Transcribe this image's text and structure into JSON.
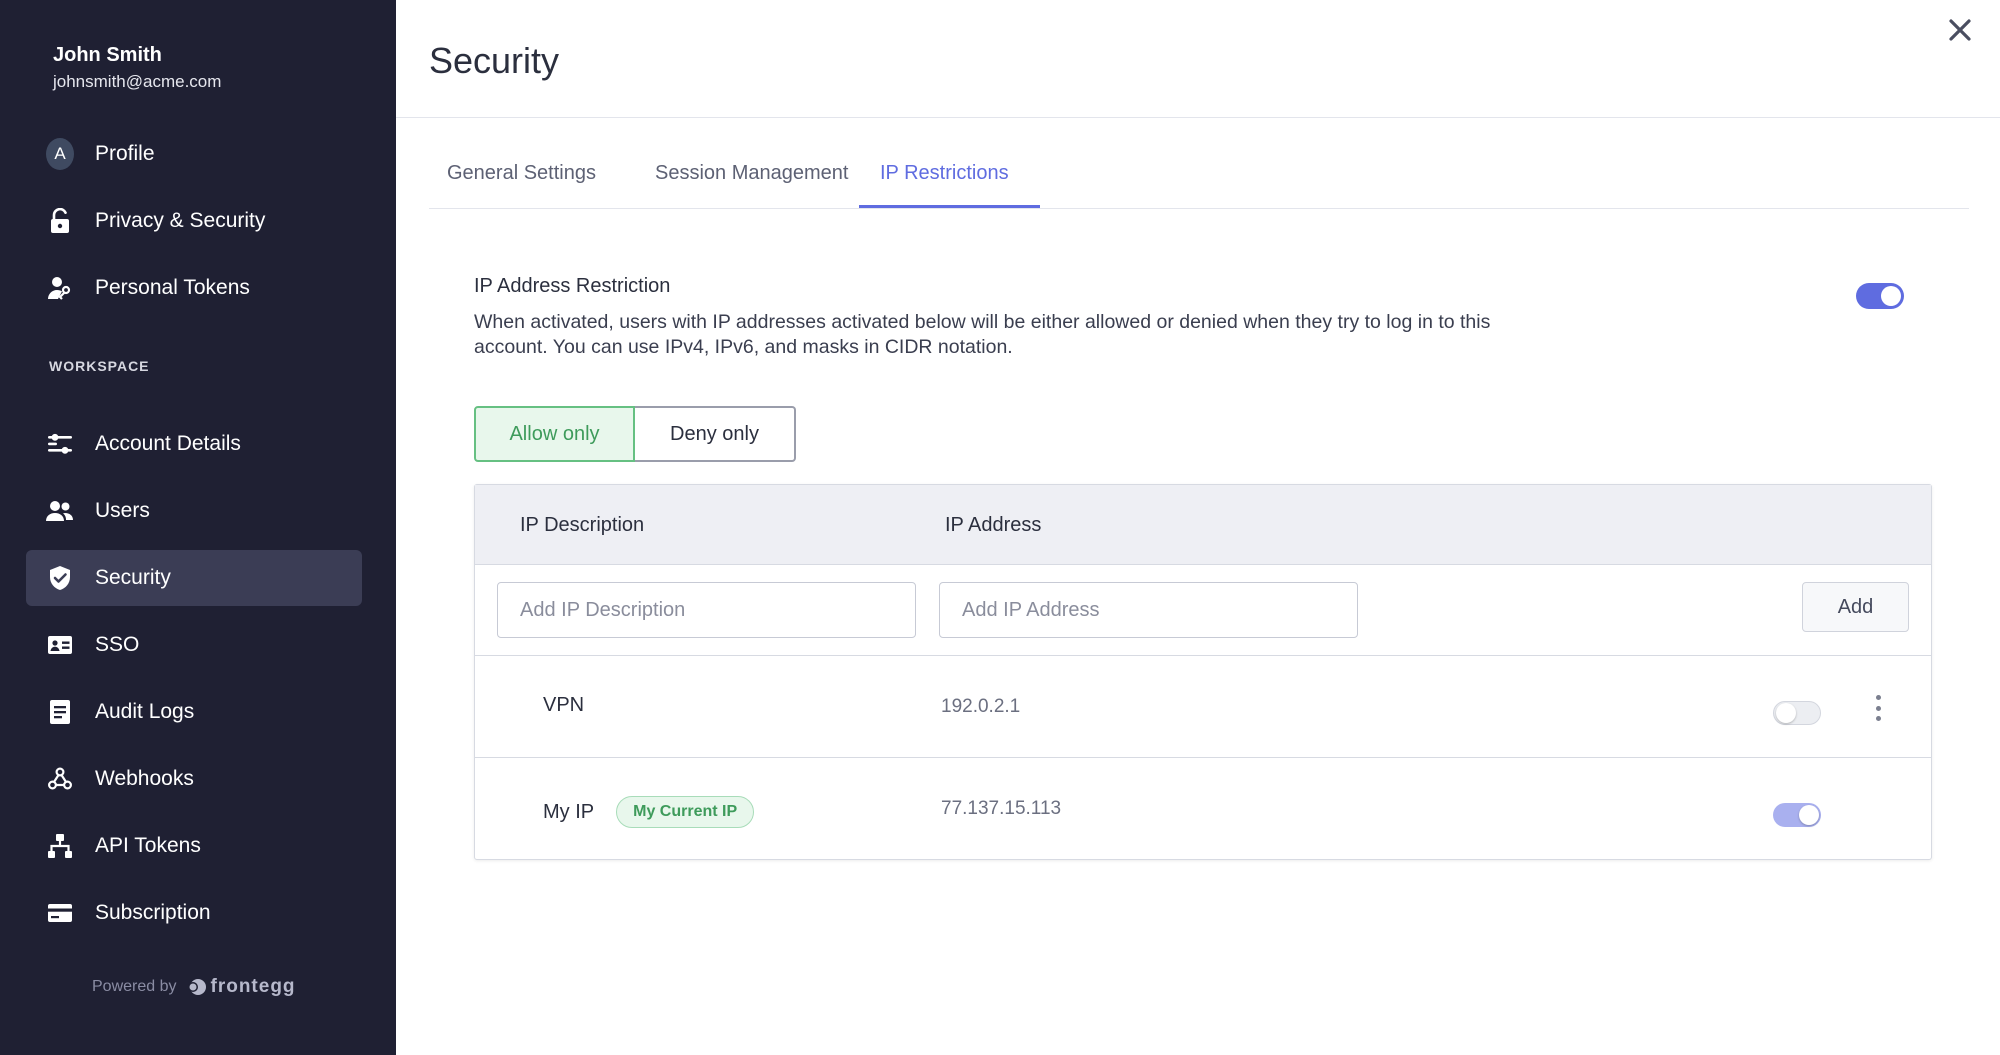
{
  "user": {
    "name": "John Smith",
    "email": "johnsmith@acme.com",
    "avatar_initial": "A"
  },
  "sidebar": {
    "personal_items": [
      {
        "label": "Profile",
        "icon": "avatar-icon"
      },
      {
        "label": "Privacy & Security",
        "icon": "lock-icon"
      },
      {
        "label": "Personal Tokens",
        "icon": "user-key-icon"
      }
    ],
    "section_label": "WORKSPACE",
    "workspace_items": [
      {
        "label": "Account Details",
        "icon": "sliders-icon"
      },
      {
        "label": "Users",
        "icon": "users-icon"
      },
      {
        "label": "Security",
        "icon": "shield-icon",
        "active": true
      },
      {
        "label": "SSO",
        "icon": "id-card-icon"
      },
      {
        "label": "Audit Logs",
        "icon": "document-icon"
      },
      {
        "label": "Webhooks",
        "icon": "webhook-icon"
      },
      {
        "label": "API Tokens",
        "icon": "hierarchy-icon"
      },
      {
        "label": "Subscription",
        "icon": "credit-card-icon"
      }
    ],
    "powered_by": "Powered by",
    "brand": "frontegg"
  },
  "page": {
    "title": "Security",
    "tabs": [
      {
        "label": "General Settings"
      },
      {
        "label": "Session Management"
      },
      {
        "label": "IP Restrictions",
        "active": true
      }
    ]
  },
  "restriction": {
    "title": "IP Address Restriction",
    "description": "When activated, users with IP addresses activated below will be either allowed or denied when they try to log in to this account. You can use IPv4, IPv6, and masks in CIDR notation.",
    "enabled": true,
    "mode_options": [
      "Allow only",
      "Deny only"
    ],
    "selected_mode": "Allow only"
  },
  "table": {
    "columns": [
      "IP Description",
      "IP Address"
    ],
    "description_placeholder": "Add IP Description",
    "address_placeholder": "Add IP Address",
    "add_label": "Add",
    "rows": [
      {
        "description": "VPN",
        "ip": "192.0.2.1",
        "enabled": false
      },
      {
        "description": "My IP",
        "badge": "My Current IP",
        "ip": "77.137.15.113",
        "enabled": true
      }
    ]
  },
  "colors": {
    "sidebar_bg": "#1f2033",
    "accent": "#5f6ce0",
    "success": "#3e9b5b"
  }
}
